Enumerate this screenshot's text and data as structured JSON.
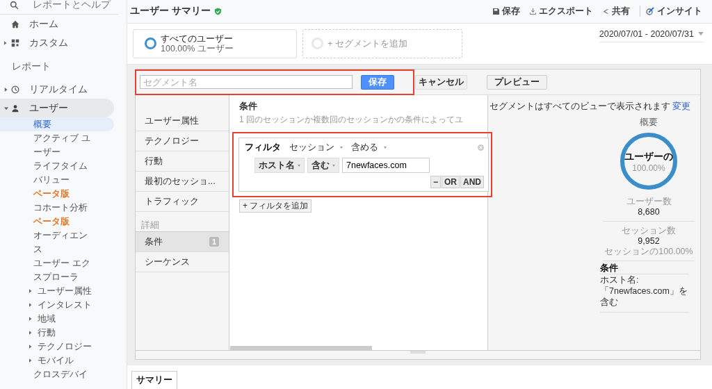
{
  "sidebar": {
    "search_label": "レポートとヘルプ",
    "top_items": [
      {
        "label": "ホーム",
        "expandable": false
      },
      {
        "label": "カスタム",
        "expandable": true
      }
    ],
    "section": "レポート",
    "items": [
      {
        "label": "リアルタイム",
        "expanded": false
      },
      {
        "label": "ユーザー",
        "expanded": true,
        "children": [
          {
            "label": "概要",
            "selected": true,
            "expandable": false
          },
          {
            "label": "アクティブ ユーザー",
            "selected": false,
            "expandable": false
          },
          {
            "label": "ライフタイムバリュー",
            "selected": false,
            "expandable": false,
            "badge": "ベータ版"
          },
          {
            "label": "コホート分析",
            "selected": false,
            "expandable": false,
            "badge": "ベータ版"
          },
          {
            "label": "オーディエンス",
            "selected": false,
            "expandable": false
          },
          {
            "label": "ユーザー エクスプローラ",
            "selected": false,
            "expandable": false
          },
          {
            "label": "ユーザー属性",
            "selected": false,
            "expandable": true
          },
          {
            "label": "インタレスト",
            "selected": false,
            "expandable": true
          },
          {
            "label": "地域",
            "selected": false,
            "expandable": true
          },
          {
            "label": "行動",
            "selected": false,
            "expandable": true
          },
          {
            "label": "テクノロジー",
            "selected": false,
            "expandable": true
          },
          {
            "label": "モバイル",
            "selected": false,
            "expandable": true
          },
          {
            "label": "クロスデバイ",
            "selected": false,
            "expandable": false
          }
        ]
      }
    ]
  },
  "header": {
    "title": "ユーザー サマリー",
    "verified": true,
    "actions": [
      {
        "label": "保存"
      },
      {
        "label": "エクスポート"
      },
      {
        "label": "共有"
      },
      {
        "label": "インサイト"
      }
    ]
  },
  "segments": [
    {
      "kind": "segment",
      "name": "すべてのユーザー",
      "share": "100.00% ユーザー"
    },
    {
      "kind": "add",
      "name": "+ セグメントを追加"
    }
  ],
  "date_range": "2020/07/01 - 2020/07/31",
  "editor": {
    "name_field": {
      "placeholder": "セグメント名"
    },
    "highlighted": true,
    "buttons": [
      {
        "label": "保存",
        "kind": "primary"
      },
      {
        "label": "キャンセル",
        "kind": "plain"
      },
      {
        "label": "プレビュー",
        "kind": "outlined"
      }
    ],
    "nav": [
      {
        "label": "ユーザー属性",
        "selected": false
      },
      {
        "label": "テクノロジー",
        "selected": false
      },
      {
        "label": "行動",
        "selected": false
      },
      {
        "label": "最初のセッショ...",
        "selected": false
      },
      {
        "label": "トラフィック",
        "selected": false
      }
    ],
    "nav_section": "詳細",
    "nav_advanced": [
      {
        "label": "条件",
        "selected": true,
        "count": "1"
      },
      {
        "label": "シーケンス",
        "selected": false
      }
    ],
    "conditions": {
      "title": "条件",
      "description": "1 回のセッションか複数回のセッションかの条件によってユ",
      "filter": {
        "highlighted": true,
        "label": "フィルタ",
        "scope": "セッション",
        "mode": "含める",
        "dimension": "ホスト名",
        "operator": "含む",
        "value": "7newfaces.com",
        "buttons": [
          "−",
          "OR",
          "AND"
        ]
      },
      "add_filter": "+ フィルタを追加"
    },
    "summary": {
      "notice": "セグメントはすべてのビューで表示されます",
      "change_link": "変更",
      "title": "概要",
      "ring_label": "ユーザーの",
      "ring_value": "100.00%",
      "level": 1,
      "stats": [
        {
          "label": "ユーザー数",
          "value": "8,680"
        },
        {
          "label": "セッション数",
          "value": "9,952",
          "share": "セッションの100.00%"
        }
      ],
      "condition_title": "条件",
      "condition_text": "ホスト名: 「7newfaces.com」を含む"
    }
  },
  "tabs": [
    {
      "label": "サマリー",
      "selected": true
    }
  ]
}
